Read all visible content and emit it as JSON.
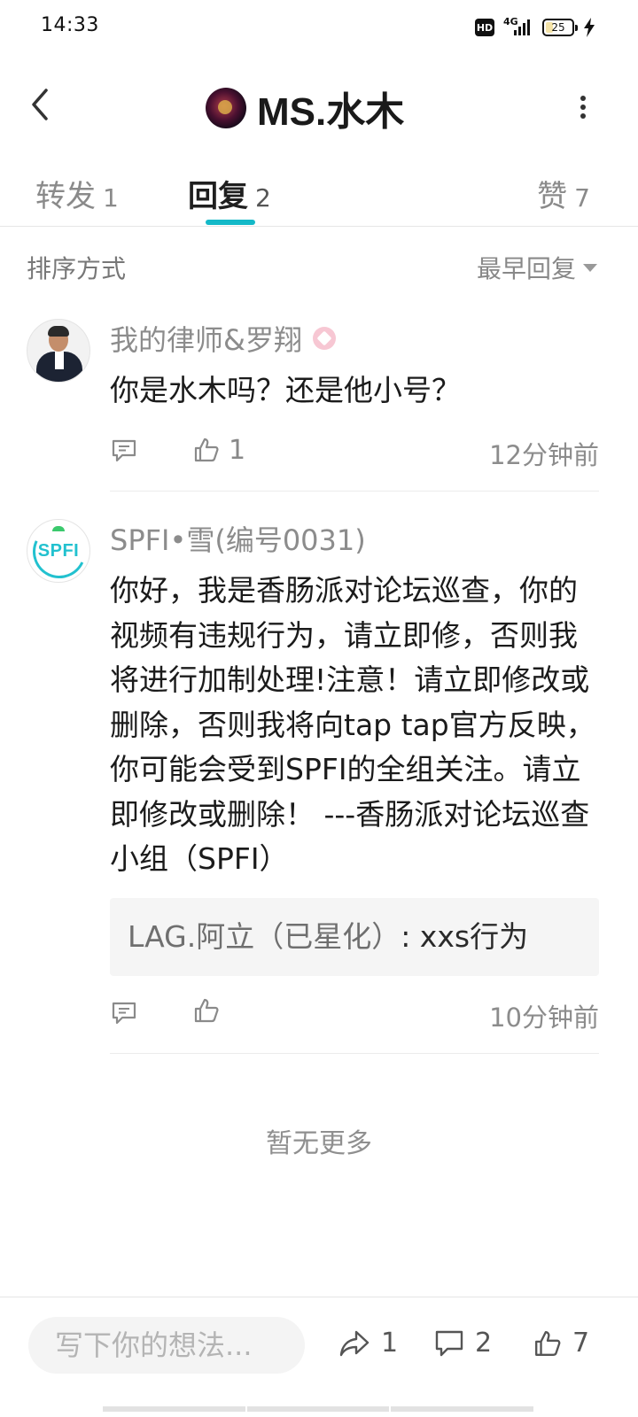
{
  "status_bar": {
    "time": "14:33",
    "hd": "HD",
    "network": "4G",
    "battery": "25",
    "battery_level_percent": 25
  },
  "header": {
    "title": "MS.水木",
    "back_icon": "chevron-left-icon",
    "more_icon": "more-vertical-icon"
  },
  "tabs": [
    {
      "label": "转发",
      "count": "1",
      "active": false
    },
    {
      "label": "回复",
      "count": "2",
      "active": true
    },
    {
      "label": "赞",
      "count": "7",
      "active": false
    }
  ],
  "colors": {
    "accent": "#14b9c8",
    "spfi_brand": "#22c1cf"
  },
  "sort": {
    "label": "排序方式",
    "selected": "最早回复"
  },
  "comments": [
    {
      "username": "我的律师&罗翔",
      "text": "你是水木吗？还是他小号？",
      "likes": "1",
      "time": "12分钟前"
    },
    {
      "username": "SPFI•雪(编号0031)",
      "avatar_text": "SPFI",
      "text": "你好，我是香肠派对论坛巡查，你的视频有违规行为，请立即修，否则我将进行加制处理!注意！请立即修改或删除，否则我将向tap tap官方反映，你可能会受到SPFI的全组关注。请立即修改或删除！ ---香肠派对论坛巡查小组（SPFI）",
      "quote": {
        "author": "LAG.阿立（已星化）",
        "text": ": xxs行为"
      },
      "likes": "",
      "time": "10分钟前"
    }
  ],
  "footer_text": "暂无更多",
  "bottom_bar": {
    "placeholder": "写下你的想法...",
    "share_count": "1",
    "comment_count": "2",
    "like_count": "7"
  }
}
